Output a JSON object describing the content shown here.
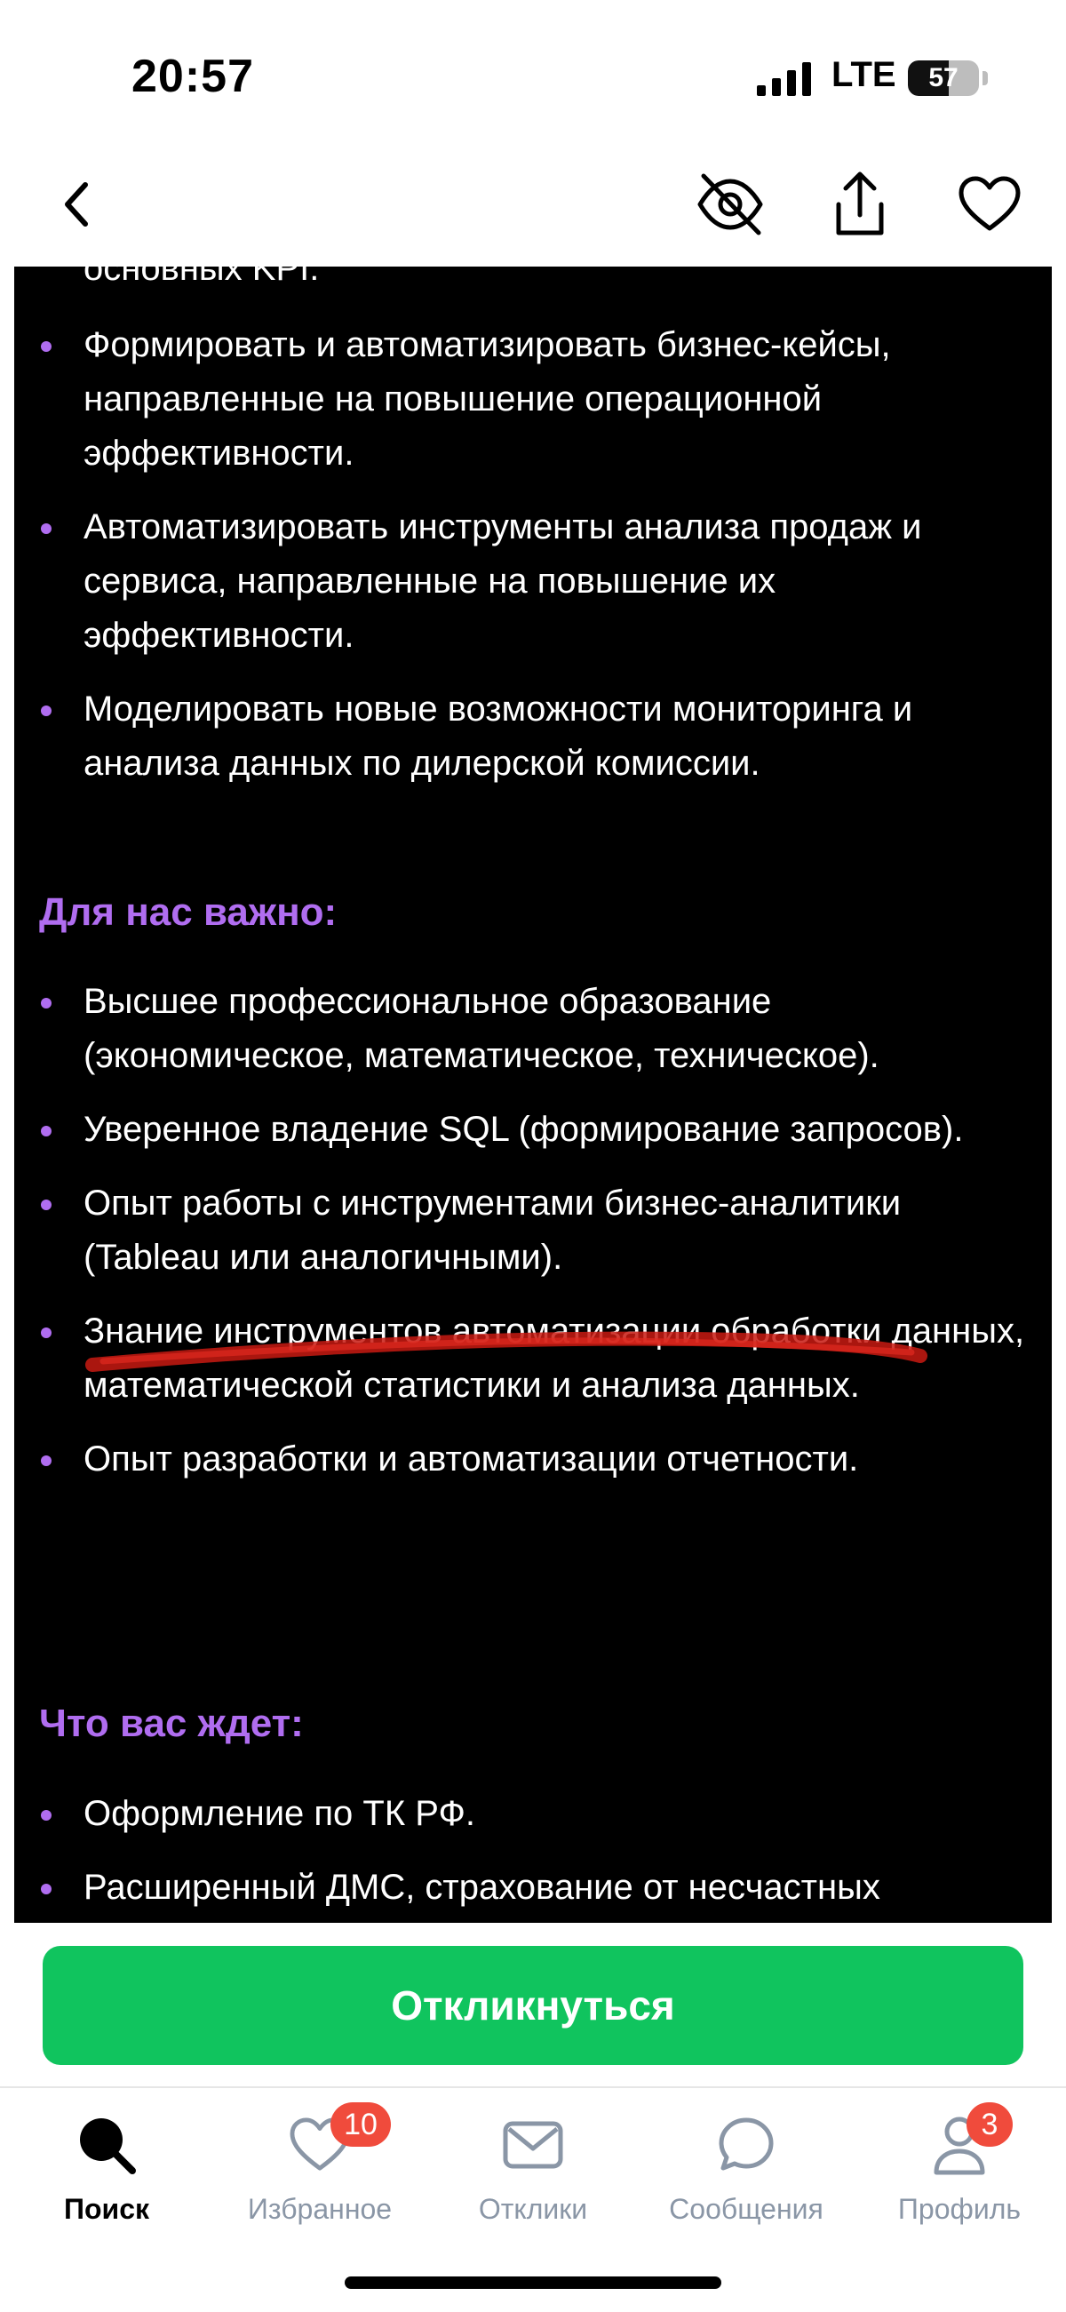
{
  "status_bar": {
    "time": "20:57",
    "network": "LTE",
    "battery_level": 57,
    "battery_text": "57"
  },
  "nav": {
    "back_icon": "chevron-left-icon",
    "hide_icon": "eye-off-icon",
    "share_icon": "share-icon",
    "favorite_icon": "heart-icon"
  },
  "content": {
    "partial_top": "основных KPI.",
    "duties": [
      "Формировать и автоматизировать бизнес-кейсы, направленные на повышение операционной эффективности.",
      "Автоматизировать инструменты анализа продаж и сервиса, направленные на повышение их эффективности.",
      "Моделировать новые возможности мониторинга и анализа данных по дилерской комиссии."
    ],
    "requirements_title": "Для нас важно:",
    "requirements": [
      "Высшее профессиональное образование (экономическое, математическое, техническое).",
      "Уверенное владение SQL (формирование запросов).",
      "Опыт работы с инструментами бизнес-аналитики (Tableau или аналогичными).",
      "Знание инструментов автоматизации обработки данных, математической статистики и анализа данных.",
      "Опыт разработки и автоматизации отчетности."
    ],
    "benefits_title": "Что вас ждет:",
    "benefits": [
      "Оформление по ТК РФ.",
      "Расширенный ДМС, страхование от несчастных"
    ]
  },
  "cta": {
    "label": "Откликнуться"
  },
  "tabs": [
    {
      "label": "Поиск",
      "icon": "search-icon",
      "active": true
    },
    {
      "label": "Избранное",
      "icon": "heart-icon",
      "badge": "10"
    },
    {
      "label": "Отклики",
      "icon": "envelope-icon"
    },
    {
      "label": "Сообщения",
      "icon": "chat-bubble-icon"
    },
    {
      "label": "Профиль",
      "icon": "person-icon",
      "badge": "3"
    }
  ],
  "colors": {
    "accent": "#b06df0",
    "cta": "#10c45e",
    "badge": "#f04b3c",
    "annotation": "#d0201a"
  }
}
